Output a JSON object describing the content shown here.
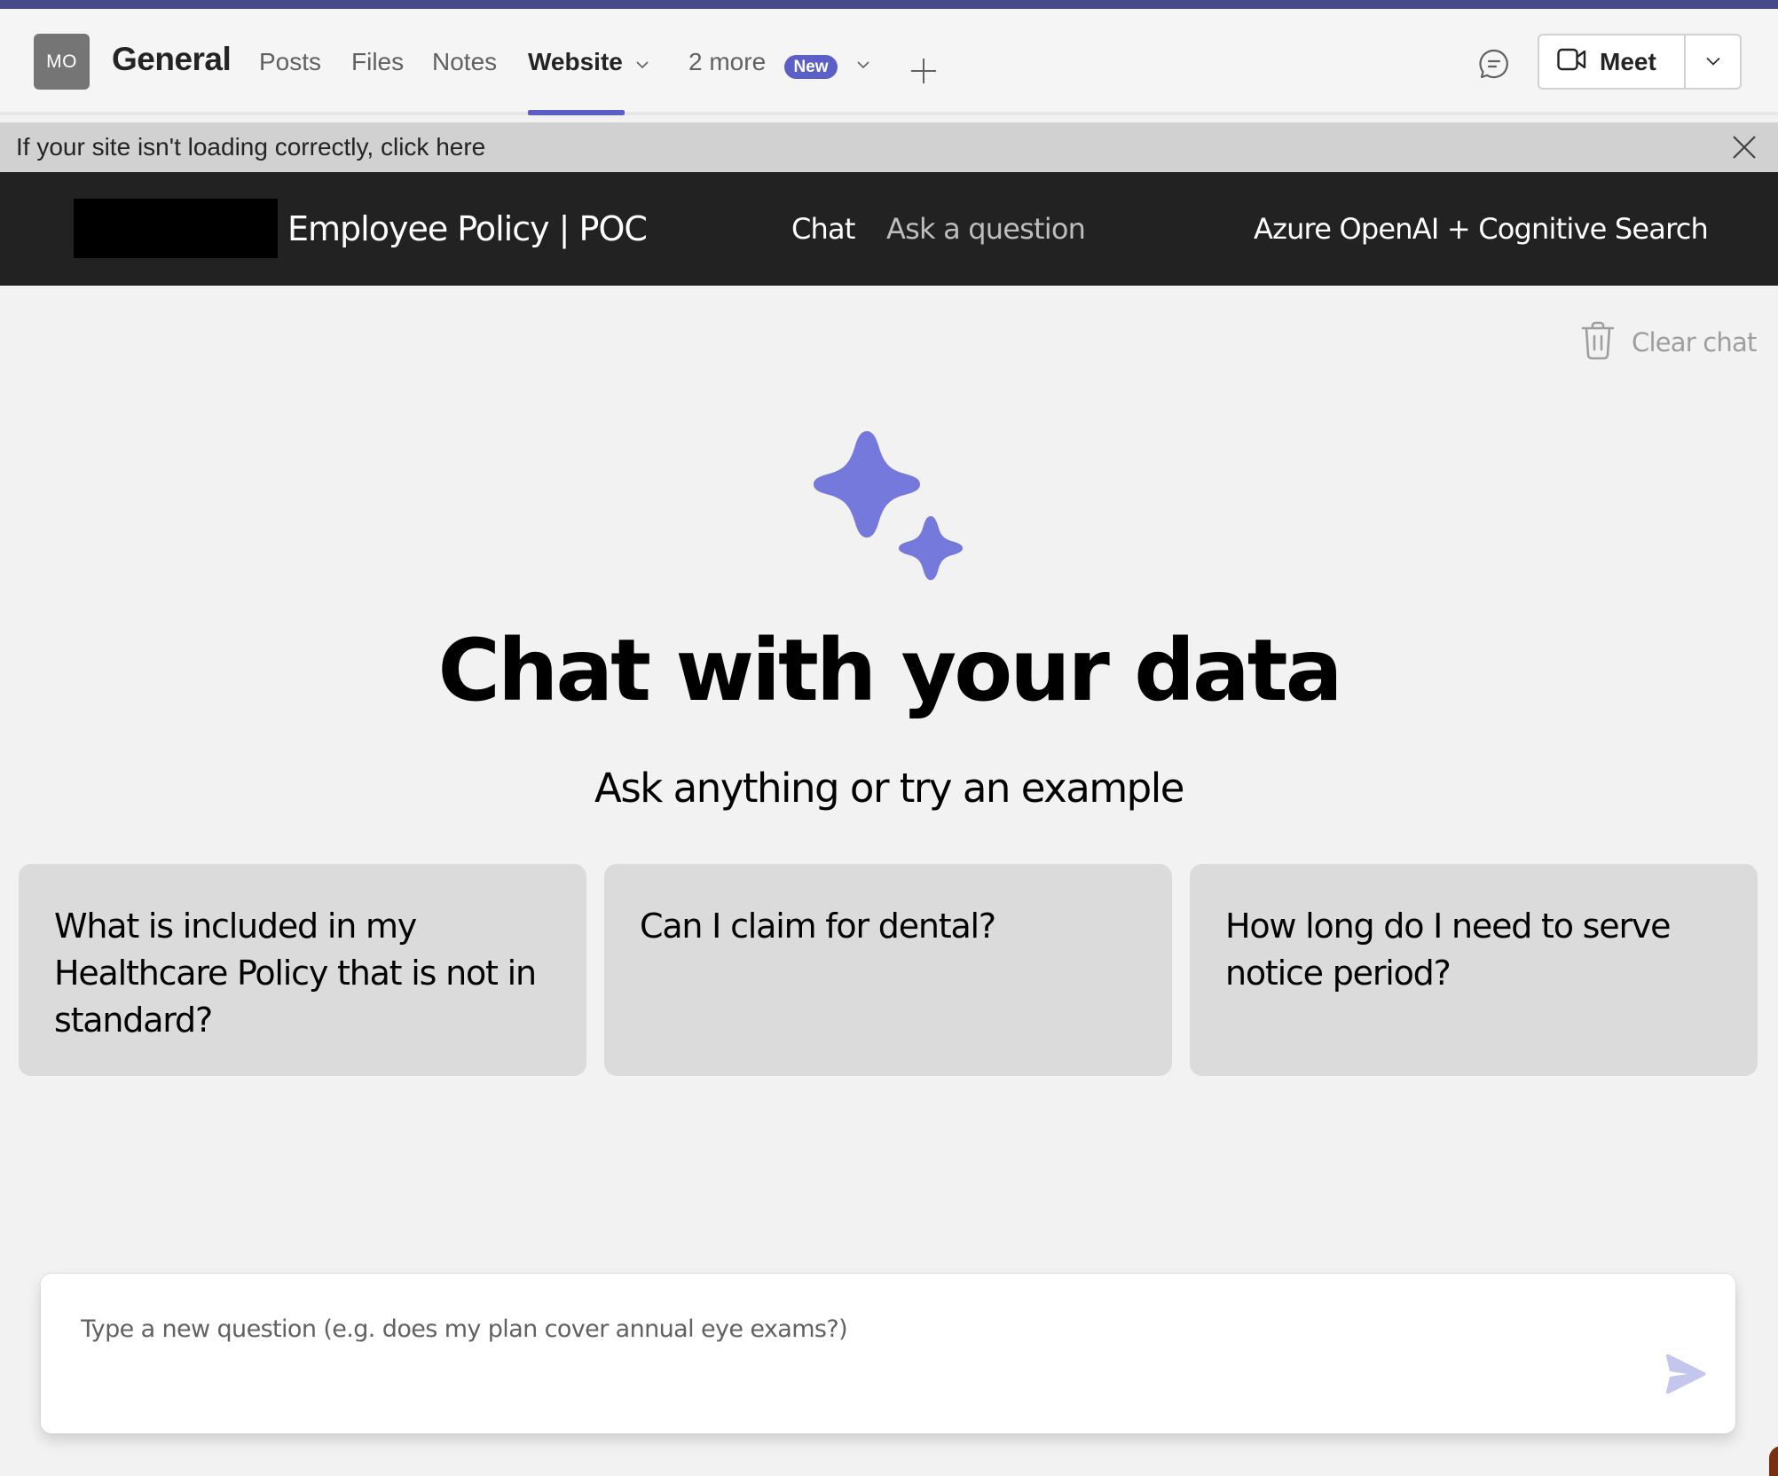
{
  "teams": {
    "avatar_initials": "MO",
    "channel_name": "General",
    "tabs": [
      {
        "label": "Posts",
        "active": false
      },
      {
        "label": "Files",
        "active": false
      },
      {
        "label": "Notes",
        "active": false
      },
      {
        "label": "Website",
        "active": true
      }
    ],
    "more_tabs_label": "2 more",
    "new_badge": "New",
    "meet_label": "Meet",
    "accent_color": "#5b5fc7"
  },
  "banner": {
    "text": "If your site isn't loading correctly, click here"
  },
  "app": {
    "title": "Employee Policy | POC",
    "nav": {
      "chat": "Chat",
      "ask": "Ask a question"
    },
    "right_label": "Azure OpenAI + Cognitive Search"
  },
  "main": {
    "clear_chat_label": "Clear chat",
    "hero_title": "Chat with your data",
    "hero_subtitle": "Ask anything or try an example",
    "examples": [
      "What is included in my Healthcare Policy that is not in standard?",
      "Can I claim for dental?",
      "How long do I need to serve notice period?"
    ],
    "question_placeholder": "Type a new question (e.g. does my plan cover annual eye exams?)",
    "question_value": "",
    "sparkle_color": "#7479db",
    "send_color": "#c5c6ee"
  }
}
